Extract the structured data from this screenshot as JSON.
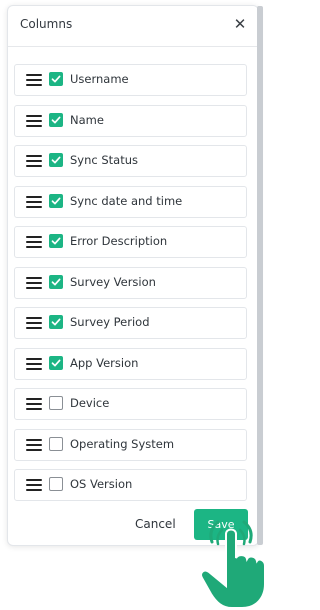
{
  "dialog": {
    "title": "Columns",
    "close_icon": "close-icon",
    "close_glyph": "✕"
  },
  "columns": [
    {
      "label": "Username",
      "checked": true
    },
    {
      "label": "Name",
      "checked": true
    },
    {
      "label": "Sync Status",
      "checked": true
    },
    {
      "label": "Sync date and time",
      "checked": true
    },
    {
      "label": "Error Description",
      "checked": true
    },
    {
      "label": "Survey Version",
      "checked": true
    },
    {
      "label": "Survey Period",
      "checked": true
    },
    {
      "label": "App Version",
      "checked": true
    },
    {
      "label": "Device",
      "checked": false
    },
    {
      "label": "Operating System",
      "checked": false
    },
    {
      "label": "OS Version",
      "checked": false
    }
  ],
  "footer": {
    "cancel_label": "Cancel",
    "save_label": "Save"
  },
  "colors": {
    "accent": "#1cb584",
    "hand": "#1fa978"
  },
  "icons": {
    "drag": "drag-handle-icon",
    "pointer": "pointer-hand-icon"
  }
}
